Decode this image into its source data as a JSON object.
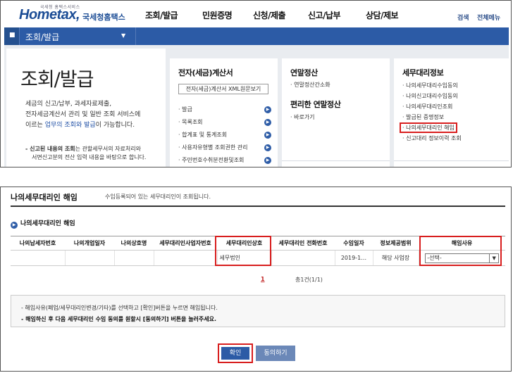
{
  "header": {
    "logo_tagline": "국세청 홈택스서비스",
    "logo_main": "Hometax,",
    "logo_kr": "국세청홈택스",
    "menu": [
      "조회/발급",
      "민원증명",
      "신청/제출",
      "신고/납부",
      "상담/제보"
    ],
    "search": "검색",
    "all_menu": "전체메뉴"
  },
  "navbar": {
    "title": "조회/발급",
    "home_icon": "home-icon"
  },
  "intro": {
    "title": "조회/발급",
    "desc_1": "세금의 신고/납부, 과세자료제출,",
    "desc_2": "전자세금계산서 관리 및 일반 조회 서비스에",
    "desc_3_pre": "이르는 ",
    "desc_3_hl": "업무의 조회와 발급",
    "desc_3_post": "이 가능합니다.",
    "note_label": "- 신고된 내용의 조회",
    "note_1": "는 관할세무서의 자료처리와",
    "note_2": "서면신고분의 전산 입력 내용을 바탕으로 합니다."
  },
  "col_invoice": {
    "title": "전자(세금)계산서",
    "button": "전자(세금)계산서 XML원문보기",
    "items": [
      "발급",
      "목록조회",
      "합계표 및 통계조회",
      "사용자유형별 조회권한 관리",
      "주민번호수취분전환및조회"
    ]
  },
  "col_yearend": {
    "title": "연말정산",
    "items": [
      "연말정산간소화"
    ],
    "title2": "편리한 연말정산",
    "items2": [
      "바로가기"
    ]
  },
  "col_agent": {
    "title": "세무대리정보",
    "items": [
      "나의세무대리수임동의",
      "나의신고대리수임동의",
      "나의세무대리인조회",
      "발급된 증명정보",
      "나의세무대리인 해임",
      "신고대리 정보이력 조회"
    ]
  },
  "dismiss": {
    "title": "나의세무대리인 해임",
    "subtitle": "수임등록되어 있는 세무대리인이 조회됩니다.",
    "section": "나의세무대리인 해임",
    "columns": [
      "나의납세자번호",
      "나의개업일자",
      "나의상호명",
      "세무대리인사업자번호",
      "세무대리인상호",
      "세무대리인 전화번호",
      "수임일자",
      "정보제공범위",
      "해임사유"
    ],
    "row": {
      "agent_name": "세무법인",
      "date": "2019-1…",
      "scope": "해당 사업장",
      "reason": "-선택-"
    },
    "page": "1",
    "page_count": "총1건(1/1)",
    "notice_1": "- 해임사유(폐업/세무대리인변경/기타)를 선택하고 [확인]버튼을 누르면 해임됩니다.",
    "notice_2": "- 해임하신 후 다음 세무대리인 수임 동의를 원할시 [동의하기] 버튼을 눌러주세요.",
    "confirm": "확인",
    "agree": "동의하기"
  },
  "colors": {
    "brand": "#2c5ba6",
    "highlight": "#d81e1e"
  }
}
